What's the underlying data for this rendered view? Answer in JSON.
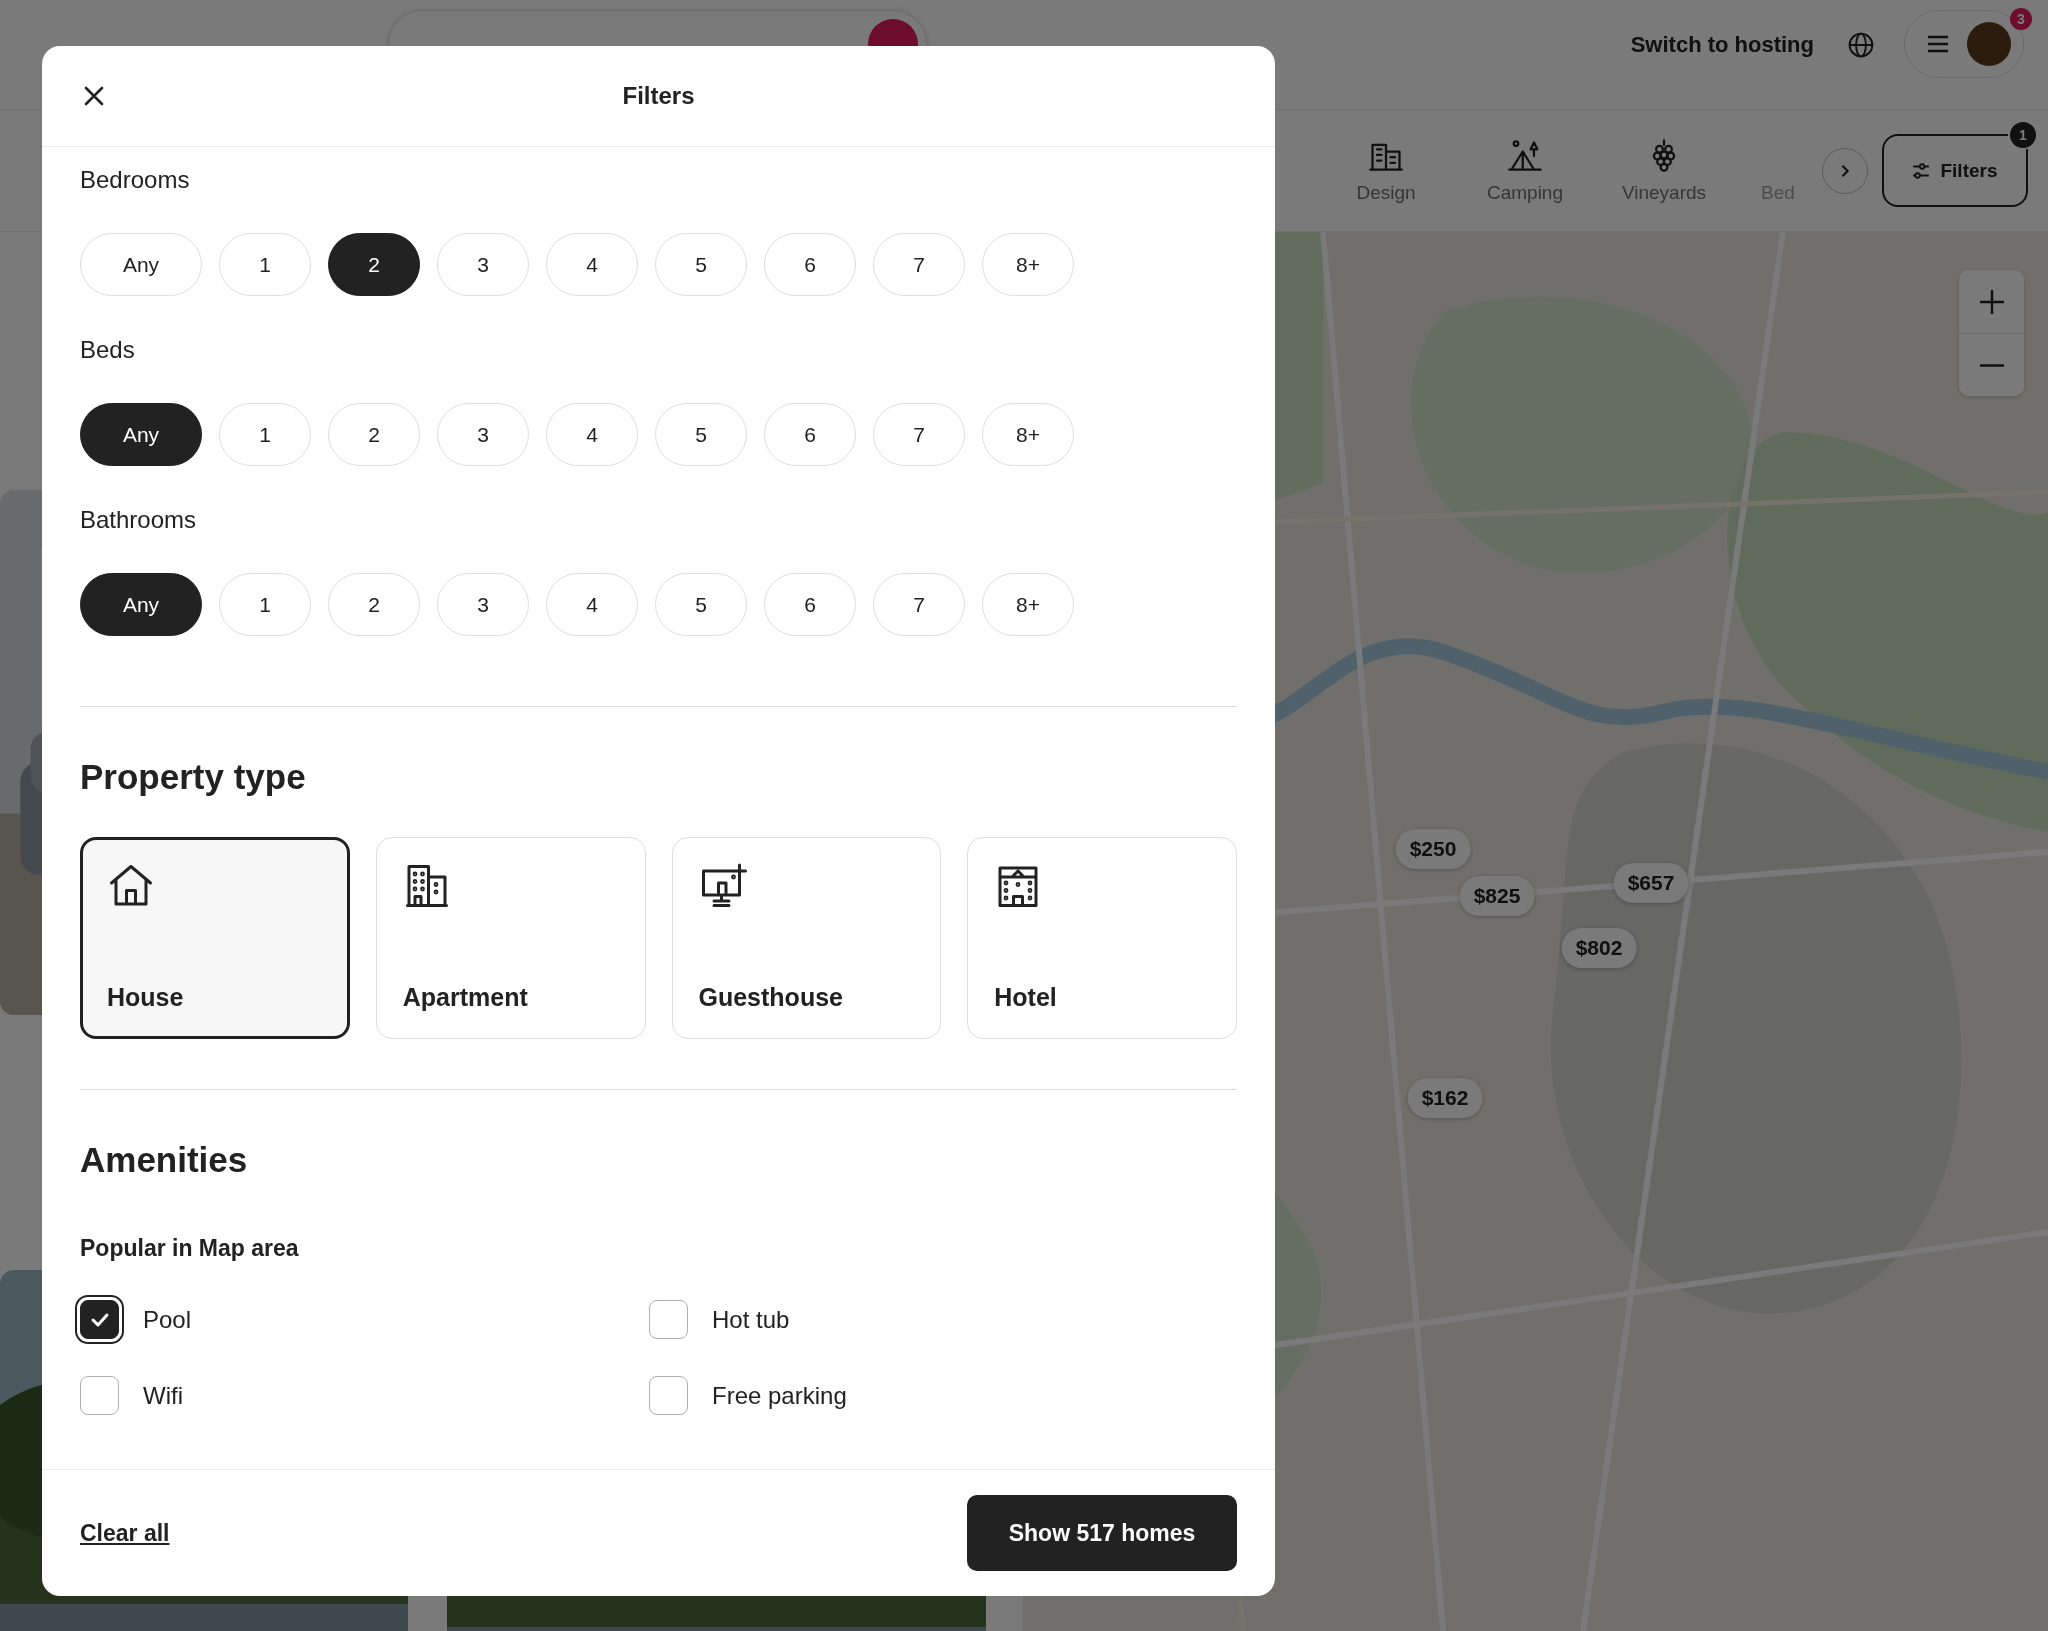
{
  "header": {
    "host_link": "Switch to hosting",
    "notification_count": "3"
  },
  "categories": [
    {
      "label": "Design",
      "kind": "building",
      "faded": false
    },
    {
      "label": "Camping",
      "kind": "tent",
      "faded": false
    },
    {
      "label": "Vineyards",
      "kind": "grapes",
      "faded": false
    },
    {
      "label": "Bed",
      "faded": true
    }
  ],
  "filters_button": {
    "label": "Filters",
    "badge": "1"
  },
  "map": {
    "price_pins": [
      {
        "label": "$250"
      },
      {
        "label": "$825"
      },
      {
        "label": "$657"
      },
      {
        "label": "$802"
      },
      {
        "label": "$162"
      }
    ]
  },
  "modal": {
    "title": "Filters",
    "room_sections": [
      {
        "title": "Bedrooms",
        "options": [
          {
            "label": "Any",
            "selected": false
          },
          {
            "label": "1",
            "selected": false
          },
          {
            "label": "2",
            "selected": true
          },
          {
            "label": "3",
            "selected": false
          },
          {
            "label": "4",
            "selected": false
          },
          {
            "label": "5",
            "selected": false
          },
          {
            "label": "6",
            "selected": false
          },
          {
            "label": "7",
            "selected": false
          },
          {
            "label": "8+",
            "selected": false
          }
        ]
      },
      {
        "title": "Beds",
        "options": [
          {
            "label": "Any",
            "selected": true
          },
          {
            "label": "1",
            "selected": false
          },
          {
            "label": "2",
            "selected": false
          },
          {
            "label": "3",
            "selected": false
          },
          {
            "label": "4",
            "selected": false
          },
          {
            "label": "5",
            "selected": false
          },
          {
            "label": "6",
            "selected": false
          },
          {
            "label": "7",
            "selected": false
          },
          {
            "label": "8+",
            "selected": false
          }
        ]
      },
      {
        "title": "Bathrooms",
        "options": [
          {
            "label": "Any",
            "selected": true
          },
          {
            "label": "1",
            "selected": false
          },
          {
            "label": "2",
            "selected": false
          },
          {
            "label": "3",
            "selected": false
          },
          {
            "label": "4",
            "selected": false
          },
          {
            "label": "5",
            "selected": false
          },
          {
            "label": "6",
            "selected": false
          },
          {
            "label": "7",
            "selected": false
          },
          {
            "label": "8+",
            "selected": false
          }
        ]
      }
    ],
    "property_type": {
      "title": "Property type",
      "items": [
        {
          "label": "House",
          "kind": "house",
          "selected": true
        },
        {
          "label": "Apartment",
          "kind": "apartment",
          "selected": false
        },
        {
          "label": "Guesthouse",
          "kind": "guesthouse",
          "selected": false
        },
        {
          "label": "Hotel",
          "kind": "hotel",
          "selected": false
        }
      ]
    },
    "amenities": {
      "title": "Amenities",
      "subtitle": "Popular in Map area",
      "items": [
        {
          "label": "Pool",
          "checked": true
        },
        {
          "label": "Hot tub",
          "checked": false
        },
        {
          "label": "Wifi",
          "checked": false
        },
        {
          "label": "Free parking",
          "checked": false
        }
      ]
    },
    "footer": {
      "clear_label": "Clear all",
      "submit_label": "Show 517 homes"
    }
  }
}
